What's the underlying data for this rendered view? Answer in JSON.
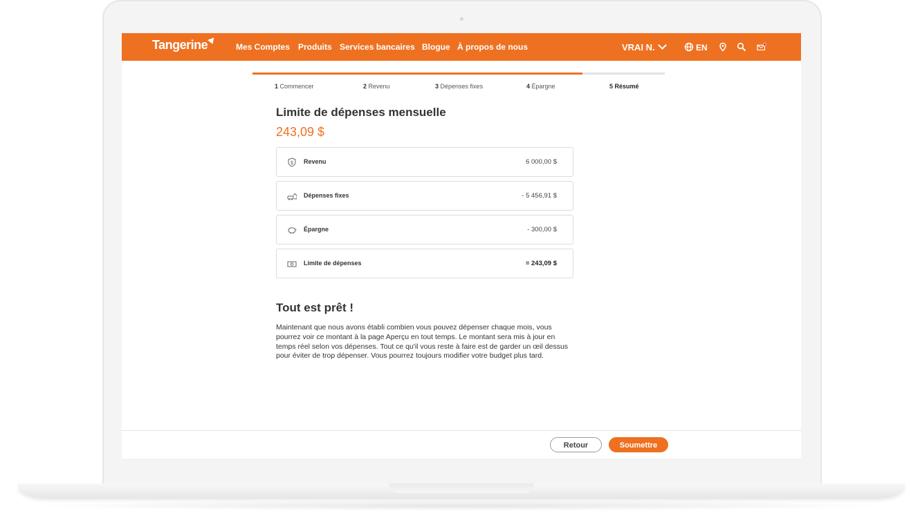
{
  "brand": {
    "logo_text": "Tangerine",
    "accent_color": "#ee7121"
  },
  "nav": {
    "items": [
      {
        "label": "Mes Comptes"
      },
      {
        "label": "Produits"
      },
      {
        "label": "Services bancaires"
      },
      {
        "label": "Blogue"
      },
      {
        "label": "À propos de nous"
      }
    ],
    "user_label": "VRAI N.",
    "language_label": "EN",
    "icons": [
      "globe-icon",
      "location-pin-icon",
      "search-icon",
      "mail-icon"
    ]
  },
  "progress": {
    "completed_fraction": 0.8,
    "steps": [
      {
        "num": "1",
        "label": "Commencer"
      },
      {
        "num": "2",
        "label": "Revenu"
      },
      {
        "num": "3",
        "label": "Dépenses fixes"
      },
      {
        "num": "4",
        "label": "Épargne"
      },
      {
        "num": "5",
        "label": "Résumé"
      }
    ]
  },
  "summary": {
    "title": "Limite de dépenses mensuelle",
    "amount": "243,09 $",
    "rows": [
      {
        "icon": "shield-dollar-icon",
        "label": "Revenu",
        "value": "6 000,00 $"
      },
      {
        "icon": "car-house-icon",
        "label": "Dépenses fixes",
        "value": "- 5 456,91 $"
      },
      {
        "icon": "piggy-bank-icon",
        "label": "Épargne",
        "value": "- 300,00 $"
      },
      {
        "icon": "banknote-icon",
        "label": "Limite de dépenses",
        "value": "= 243,09 $"
      }
    ]
  },
  "ready": {
    "title": "Tout est prêt !",
    "text": "Maintenant que nous avons établi combien vous pouvez dépenser chaque mois, vous pourrez voir ce montant à la page Aperçu en tout temps. Le montant sera mis à jour en temps réel selon vos dépenses. Tout ce qu'il vous reste à faire est de garder un œil dessus pour éviter de trop dépenser. Vous pourrez toujours modifier votre budget plus tard."
  },
  "footer": {
    "back_label": "Retour",
    "submit_label": "Soumettre"
  }
}
